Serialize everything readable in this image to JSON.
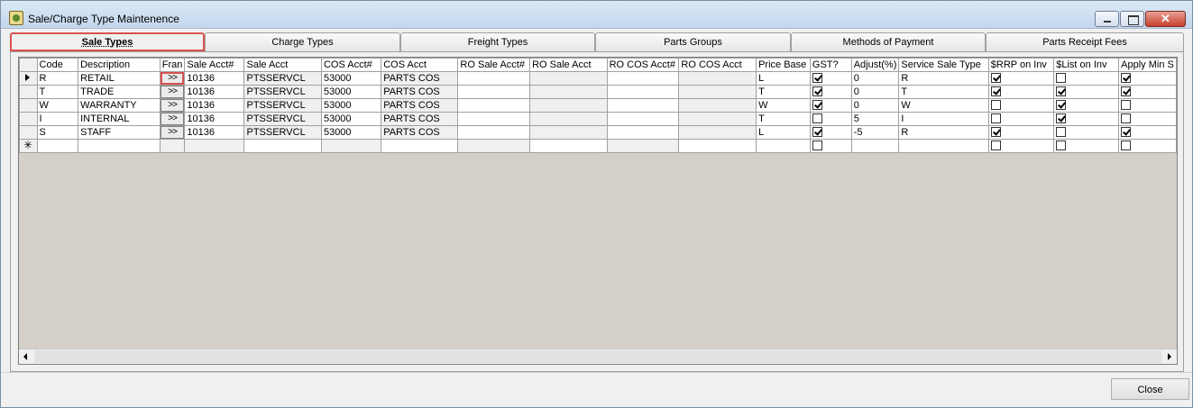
{
  "window": {
    "title": "Sale/Charge Type Maintenence"
  },
  "window_buttons": {
    "close_glyph": "✕"
  },
  "tabs": [
    {
      "label": "Sale Types",
      "active": true
    },
    {
      "label": "Charge Types",
      "active": false
    },
    {
      "label": "Freight Types",
      "active": false
    },
    {
      "label": "Parts Groups",
      "active": false
    },
    {
      "label": "Methods of Payment",
      "active": false
    },
    {
      "label": "Parts Receipt Fees",
      "active": false
    }
  ],
  "grid": {
    "columns": [
      "Code",
      "Description",
      "Fran",
      "Sale Acct#",
      "Sale Acct",
      "COS Acct#",
      "COS Acct",
      "RO Sale Acct#",
      "RO Sale Acct",
      "RO COS Acct#",
      "RO COS Acct",
      "Price Base",
      "GST?",
      "Adjust(%)",
      "Service Sale Type",
      "$RRP on Inv",
      "$List on Inv",
      "Apply Min S"
    ],
    "fran_button_label": ">>",
    "rows": [
      {
        "code": "R",
        "description": "RETAIL",
        "sale_acct_no": "10136",
        "sale_acct": "PTSSERVCL",
        "cos_acct_no": "53000",
        "cos_acct": "PARTS COS",
        "ro_sale_acct_no": "",
        "ro_sale_acct": "",
        "ro_cos_acct_no": "",
        "ro_cos_acct": "",
        "price_base": "L",
        "gst": true,
        "adjust": "0",
        "service_sale_type": "R",
        "rrp_on_inv": true,
        "list_on_inv": false,
        "apply_min": true
      },
      {
        "code": "T",
        "description": "TRADE",
        "sale_acct_no": "10136",
        "sale_acct": "PTSSERVCL",
        "cos_acct_no": "53000",
        "cos_acct": "PARTS COS",
        "ro_sale_acct_no": "",
        "ro_sale_acct": "",
        "ro_cos_acct_no": "",
        "ro_cos_acct": "",
        "price_base": "T",
        "gst": true,
        "adjust": "0",
        "service_sale_type": "T",
        "rrp_on_inv": true,
        "list_on_inv": true,
        "apply_min": true
      },
      {
        "code": "W",
        "description": "WARRANTY",
        "sale_acct_no": "10136",
        "sale_acct": "PTSSERVCL",
        "cos_acct_no": "53000",
        "cos_acct": "PARTS COS",
        "ro_sale_acct_no": "",
        "ro_sale_acct": "",
        "ro_cos_acct_no": "",
        "ro_cos_acct": "",
        "price_base": "W",
        "gst": true,
        "adjust": "0",
        "service_sale_type": "W",
        "rrp_on_inv": false,
        "list_on_inv": true,
        "apply_min": false
      },
      {
        "code": "I",
        "description": "INTERNAL",
        "sale_acct_no": "10136",
        "sale_acct": "PTSSERVCL",
        "cos_acct_no": "53000",
        "cos_acct": "PARTS COS",
        "ro_sale_acct_no": "",
        "ro_sale_acct": "",
        "ro_cos_acct_no": "",
        "ro_cos_acct": "",
        "price_base": "T",
        "gst": false,
        "adjust": "5",
        "service_sale_type": "I",
        "rrp_on_inv": false,
        "list_on_inv": true,
        "apply_min": false
      },
      {
        "code": "S",
        "description": "STAFF",
        "sale_acct_no": "10136",
        "sale_acct": "PTSSERVCL",
        "cos_acct_no": "53000",
        "cos_acct": "PARTS COS",
        "ro_sale_acct_no": "",
        "ro_sale_acct": "",
        "ro_cos_acct_no": "",
        "ro_cos_acct": "",
        "price_base": "L",
        "gst": true,
        "adjust": "-5",
        "service_sale_type": "R",
        "rrp_on_inv": true,
        "list_on_inv": false,
        "apply_min": true
      }
    ]
  },
  "footer": {
    "close_label": "Close"
  }
}
